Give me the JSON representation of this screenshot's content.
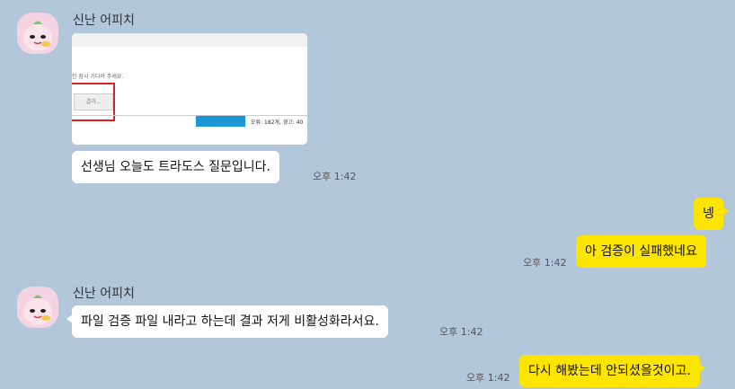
{
  "messages": [
    {
      "sender": "신난 어피치"
    },
    {
      "image": {
        "dialog_text": "인 잠시 기다려 주세요.",
        "button_label": "결과...",
        "status_text": "오류: 182개, 경고: 40"
      }
    },
    {
      "text": "선생님 오늘도 트라도스 질문입니다.",
      "time": "오후 1:42"
    },
    {
      "text": "넹"
    },
    {
      "text": "아 검증이 실패했네요",
      "time": "오후 1:42"
    },
    {
      "sender": "신난 어피치"
    },
    {
      "text": "파일 검증 파일 내라고 하는데 결과 저게 비활성화라서요.",
      "time": "오후 1:42"
    },
    {
      "text": "다시 해봤는데 안되셨을것이고.",
      "time": "오후 1:42"
    }
  ],
  "colors": {
    "background": "#b2c7da",
    "incoming_bubble": "#ffffff",
    "outgoing_bubble": "#fee500",
    "highlight_box": "#d4212a",
    "progress_bar": "#1a96d4"
  },
  "icons": {
    "avatar": "apeach-avatar-icon"
  }
}
